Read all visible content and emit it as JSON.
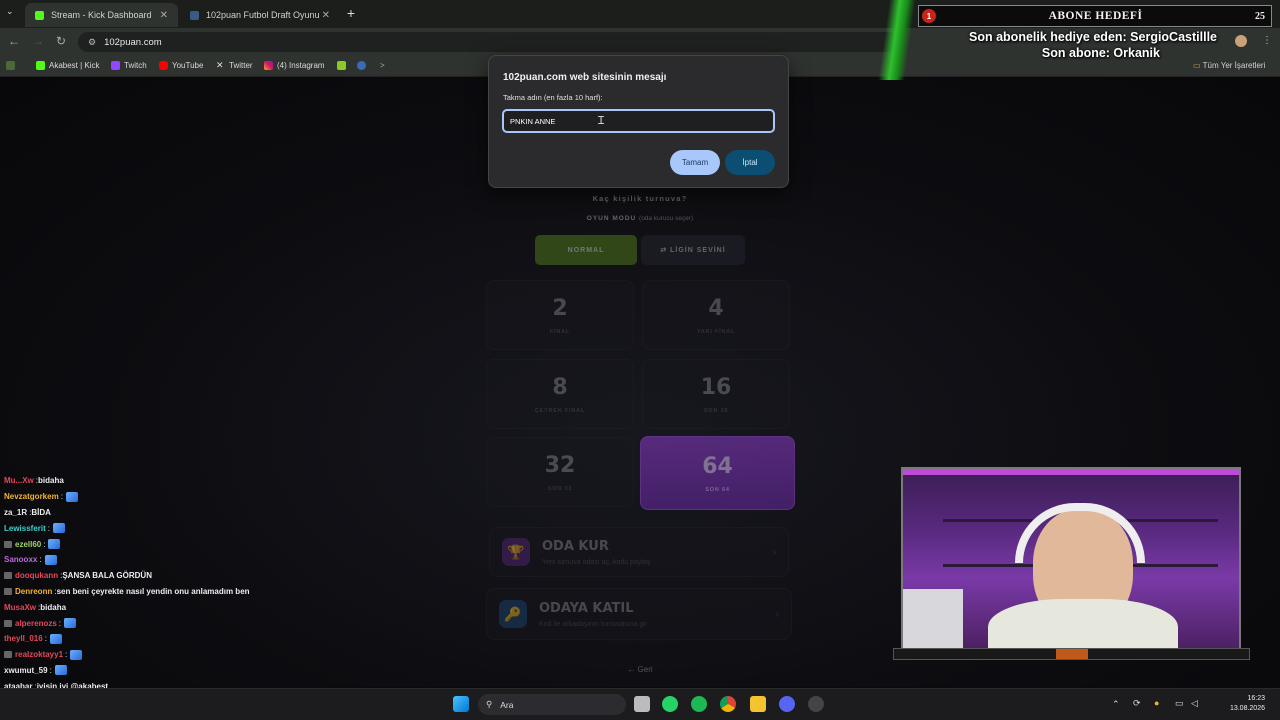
{
  "browser": {
    "tabs": [
      {
        "label": "Stream - Kick Dashboard",
        "icon": "kick-favicon",
        "active": true
      },
      {
        "label": "102puan Futbol Draft Oyunu",
        "icon": "site-favicon",
        "active": false
      }
    ],
    "url": "102puan.com",
    "bookmarks": [
      {
        "label": "Akabest | Kick",
        "icon": "kick-icon"
      },
      {
        "label": "Twitch",
        "icon": "twitch-icon"
      },
      {
        "label": "YouTube",
        "icon": "youtube-icon"
      },
      {
        "label": "Twitter",
        "icon": "x-icon"
      },
      {
        "label": "(4) Instagram",
        "icon": "instagram-icon"
      }
    ],
    "all_bookmarks": "Tüm Yer İşaretleri"
  },
  "dialog": {
    "title": "102puan.com web sitesinin mesajı",
    "label": "Takma adın (en fazla 10 harf):",
    "value": "PNKIN ANNE",
    "ok": "Tamam",
    "cancel": "İptal"
  },
  "page": {
    "subtitle": "Kaç kişilik turnuva?",
    "mode_label": "OYUN MODU",
    "mode_hint": "(oda kurucu seçer)",
    "mode_normal": "NORMAL",
    "mode_league": "⇄ LİGİN SEVİNİ",
    "cards": [
      {
        "num": "2",
        "label": "FİNAL",
        "selected": false
      },
      {
        "num": "4",
        "label": "YARI FİNAL",
        "selected": false
      },
      {
        "num": "8",
        "label": "ÇEYREK FİNAL",
        "selected": false
      },
      {
        "num": "16",
        "label": "SON 16",
        "selected": false
      },
      {
        "num": "32",
        "label": "SON 32",
        "selected": false
      },
      {
        "num": "64",
        "label": "SON 64",
        "selected": true
      }
    ],
    "create_room_title": "ODA KUR",
    "create_room_sub": "Yeni turnuva odası aç, kodu paylaş",
    "join_room_title": "ODAYA KATIL",
    "join_room_sub": "Kod ile arkadaşının turnuvasına gir",
    "back": "← Geri"
  },
  "overlay": {
    "goal_count": "1",
    "goal_title": "ABONE HEDEFİ",
    "goal_target": "25",
    "gifter_line": "Son abonelik hediye eden: SergioCastillle",
    "sub_line": "Son abone: Orkanik"
  },
  "chat": [
    {
      "user": "Mu...Xw",
      "color": "#e0495a",
      "msg": "bidaha",
      "badge": false,
      "emote": false
    },
    {
      "user": "Nevzatgorkem",
      "color": "#f2b233",
      "msg": "",
      "badge": false,
      "emote": true
    },
    {
      "user": "za_1R",
      "color": "#e8e8e8",
      "msg": "BİDA",
      "badge": false,
      "emote": false
    },
    {
      "user": "Lewissferit",
      "color": "#3ad0c8",
      "msg": "",
      "badge": false,
      "emote": true
    },
    {
      "user": "ezell60",
      "color": "#9fd36a",
      "msg": "",
      "badge": true,
      "emote": true
    },
    {
      "user": "Sanooxx",
      "color": "#b86be0",
      "msg": "",
      "badge": false,
      "emote": true
    },
    {
      "user": "dooqukann",
      "color": "#e0495a",
      "msg": "ŞANSA BALA GÖRDÜN",
      "badge": true,
      "emote": false
    },
    {
      "user": "Denreonn",
      "color": "#f2b233",
      "msg": "sen beni çeyrekte nasıl yendin onu anlamadım ben",
      "badge": true,
      "emote": false
    },
    {
      "user": "MusaXw",
      "color": "#e0495a",
      "msg": "bidaha",
      "badge": false,
      "emote": false
    },
    {
      "user": "alperenozs",
      "color": "#e0495a",
      "msg": "",
      "badge": true,
      "emote": true
    },
    {
      "user": "theyll_016",
      "color": "#e0495a",
      "msg": "",
      "badge": false,
      "emote": true
    },
    {
      "user": "realzoktayy1",
      "color": "#e0495a",
      "msg": "",
      "badge": true,
      "emote": true
    },
    {
      "user": "xwumut_59",
      "color": "#e8e8e8",
      "msg": "",
      "badge": false,
      "emote": true
    },
    {
      "user": "ataabar",
      "color": "#e8e8e8",
      "msg": "iyisin iyi @akabest",
      "badge": false,
      "emote": false
    }
  ],
  "taskbar": {
    "search": "Ara",
    "time": "16:23",
    "date": "13.08.2026"
  },
  "colors": {
    "accent_purple": "#7a34b8",
    "green": "#5a8a1a",
    "dialog_ok": "#a8c7fa",
    "dialog_cancel": "#0c4e72"
  }
}
